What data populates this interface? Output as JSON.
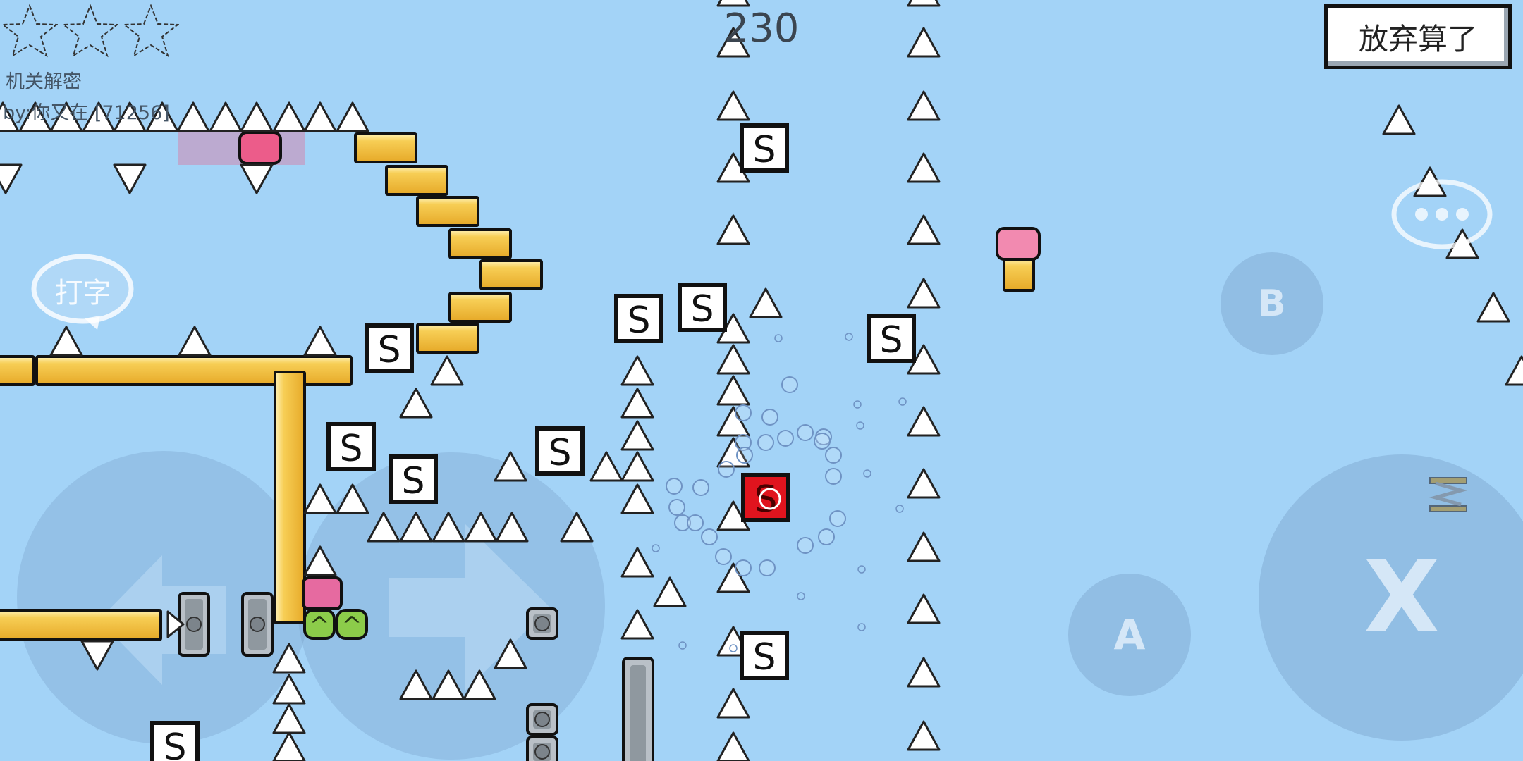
{
  "hud": {
    "stars_earned": 0,
    "stars_total": 3,
    "level_name": "机关解密",
    "level_author": "by:你又在 [71256]",
    "score": "230",
    "give_up_label": "放弃算了",
    "chat_icon": "speech-bubble-dots-icon",
    "type_label": "打字"
  },
  "controls": {
    "left": "arrow-left-icon",
    "right": "arrow-right-icon",
    "a_label": "A",
    "b_label": "B",
    "x_label": "X"
  },
  "tiles": {
    "save_label": "S",
    "bounce_label": "^"
  },
  "colors": {
    "sky": "#a3d3f7",
    "platform": "#f5c03e",
    "spike": "#ffffff",
    "save_block_active": "#e0141e",
    "pink_button": "#ec5c8a",
    "bounce_pad": "#8ccc4a"
  }
}
